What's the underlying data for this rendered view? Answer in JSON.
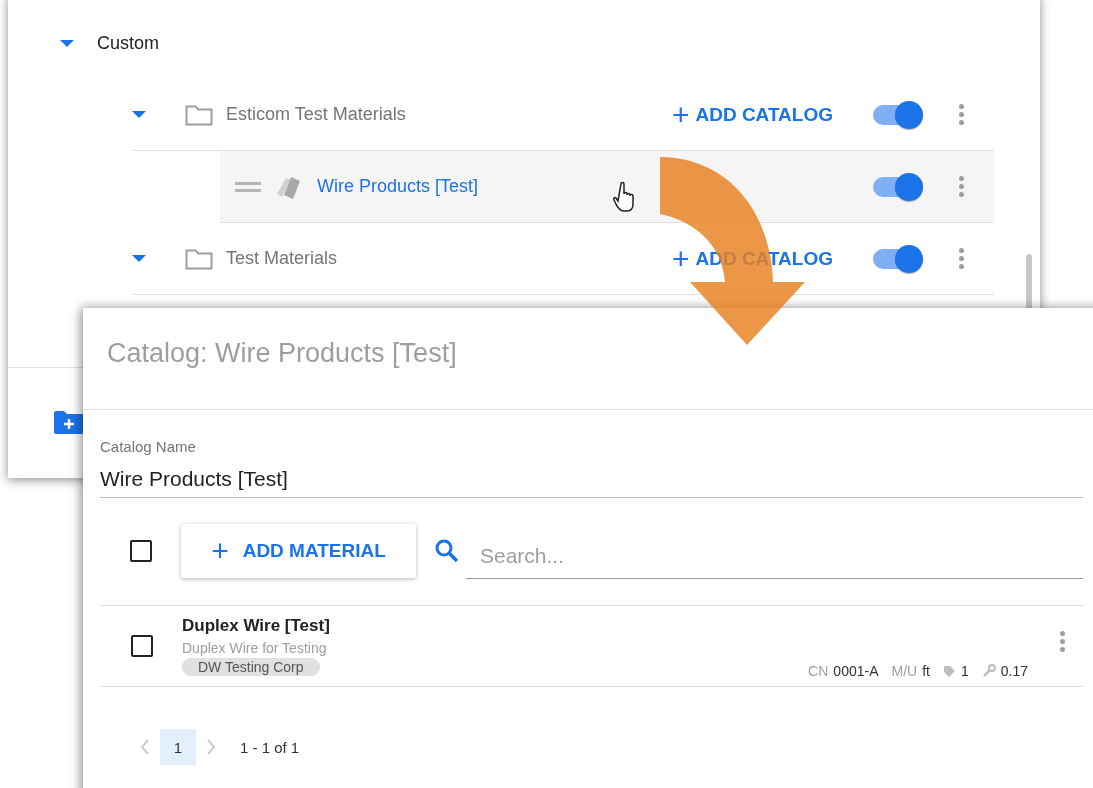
{
  "tree": {
    "label": "Custom",
    "expanded": true,
    "children": [
      {
        "kind": "folder",
        "label": "Esticom Test Materials",
        "expanded": true,
        "on": true,
        "action": "ADD CATALOG",
        "action_icon": "+",
        "children": [
          {
            "kind": "catalog",
            "label": "Wire Products [Test]",
            "on": true,
            "hovered": true
          }
        ]
      },
      {
        "kind": "folder",
        "label": "Test Materials",
        "expanded": true,
        "on": true,
        "action": "ADD CATALOG",
        "action_icon": "+"
      }
    ]
  },
  "dialog": {
    "title": "Catalog: Wire Products [Test]",
    "field": {
      "label": "Catalog Name",
      "value": "Wire Products [Test]"
    },
    "select_all": {
      "checked": false
    },
    "add_button": {
      "icon": "+",
      "label": "ADD MATERIAL"
    },
    "search": {
      "placeholder": "Search..."
    },
    "materials": [
      {
        "checked": false,
        "name": "Duplex Wire [Test]",
        "description": "Duplex Wire for Testing",
        "vendor": "DW Testing Corp",
        "cn_label": "CN",
        "cn": "0001-A",
        "mu_label": "M/U",
        "mu": "ft",
        "tag_count": "1",
        "labor": "0.17"
      }
    ],
    "pagination": {
      "pages": [
        {
          "label": "1",
          "selected": true
        }
      ],
      "range": "1 - 1 of 1"
    }
  }
}
